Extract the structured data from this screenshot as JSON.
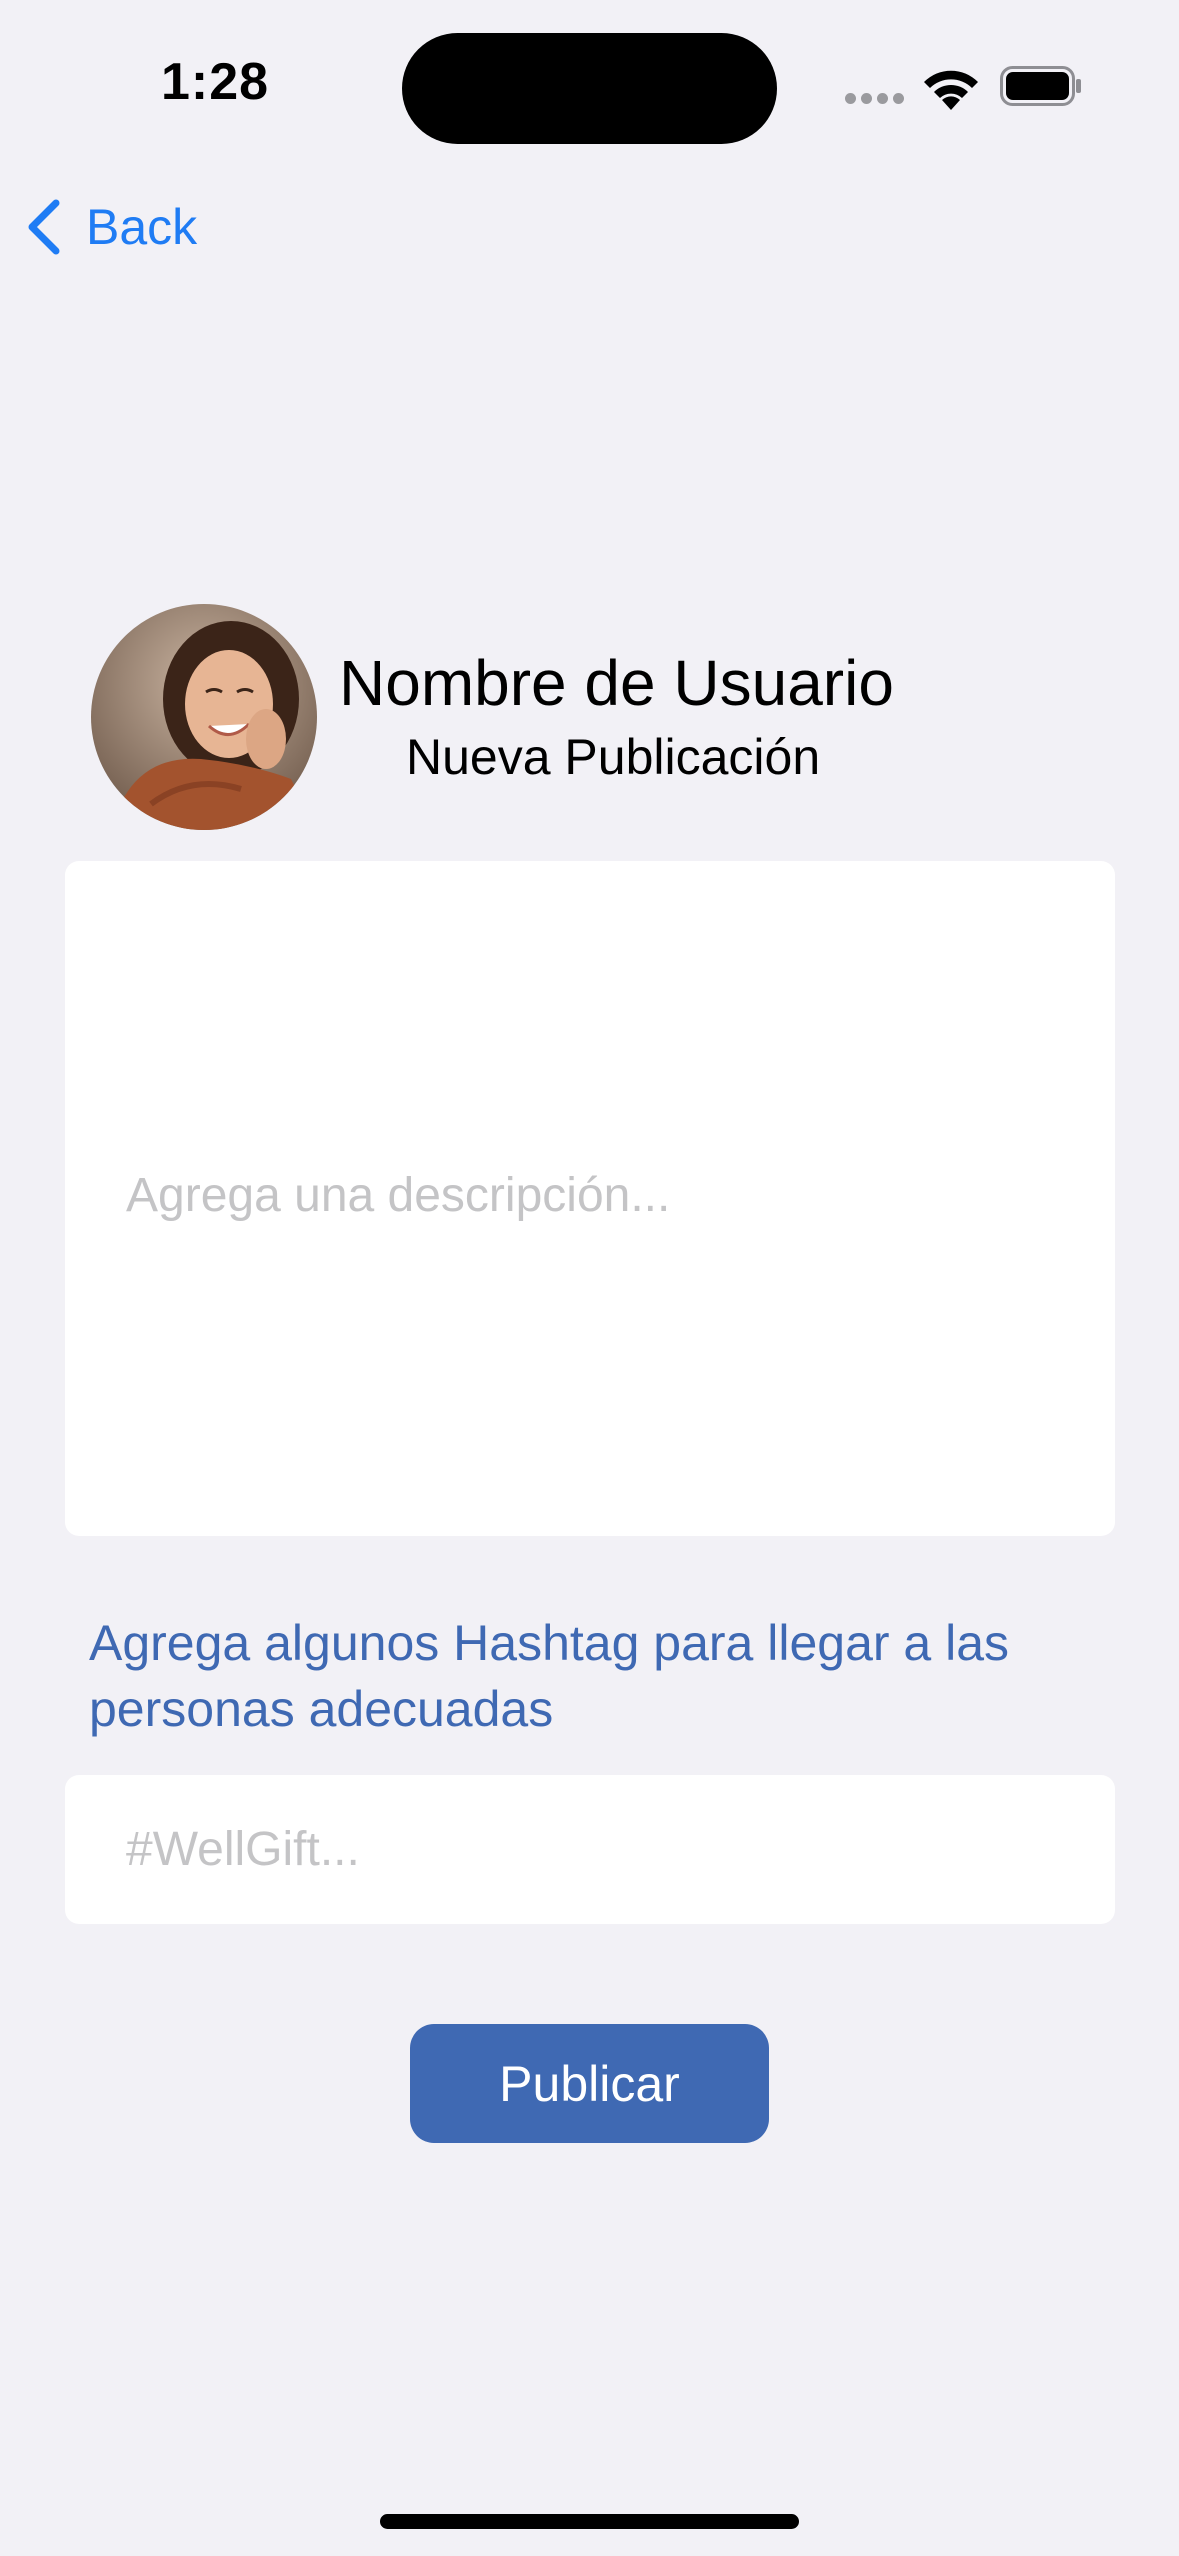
{
  "status_bar": {
    "time": "1:28"
  },
  "nav": {
    "back_label": "Back",
    "back_icon": "chevron-left-icon"
  },
  "profile": {
    "user_name": "Nombre de Usuario",
    "subtitle": "Nueva Publicación",
    "avatar_icon": "user-avatar-photo"
  },
  "description_field": {
    "value": "",
    "placeholder": "Agrega una descripción..."
  },
  "hashtag_hint": "Agrega algunos Hashtag para llegar a las personas adecuadas",
  "hashtag_field": {
    "value": "",
    "placeholder": "#WellGift..."
  },
  "publish_button": {
    "label": "Publicar"
  },
  "colors": {
    "background": "#f2f1f6",
    "accent_link": "#1f7cf4",
    "brand_blue": "#3f69b3",
    "placeholder_gray": "#c4c4c6",
    "field_background": "#ffffff"
  }
}
